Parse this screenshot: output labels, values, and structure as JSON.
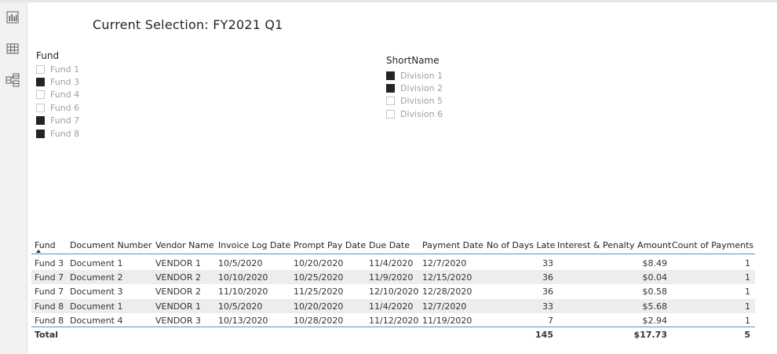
{
  "rail": {
    "icons": [
      "report-view-icon",
      "data-view-icon",
      "model-view-icon"
    ]
  },
  "page": {
    "title": "Current Selection: FY2021 Q1"
  },
  "slicers": {
    "fund": {
      "header": "Fund",
      "items": [
        {
          "label": "Fund 1",
          "checked": false
        },
        {
          "label": "Fund 3",
          "checked": true
        },
        {
          "label": "Fund 4",
          "checked": false
        },
        {
          "label": "Fund 6",
          "checked": false
        },
        {
          "label": "Fund 7",
          "checked": true
        },
        {
          "label": "Fund 8",
          "checked": true
        }
      ]
    },
    "shortname": {
      "header": "ShortName",
      "items": [
        {
          "label": "Division 1",
          "checked": true
        },
        {
          "label": "Division 2",
          "checked": true
        },
        {
          "label": "Division 5",
          "checked": false
        },
        {
          "label": "Division 6",
          "checked": false
        }
      ]
    }
  },
  "table": {
    "columns": [
      "Fund",
      "Document Number",
      "Vendor Name",
      "Invoice Log Date",
      "Prompt Pay Date",
      "Due Date",
      "Payment Date",
      "No of Days Late",
      "Interest & Penalty Amount",
      "Count of Payments"
    ],
    "rows": [
      [
        "Fund 3",
        "Document 1",
        "VENDOR 1",
        "10/5/2020",
        "10/20/2020",
        "11/4/2020",
        "12/7/2020",
        "33",
        "$8.49",
        "1"
      ],
      [
        "Fund 7",
        "Document 2",
        "VENDOR 2",
        "10/10/2020",
        "10/25/2020",
        "11/9/2020",
        "12/15/2020",
        "36",
        "$0.04",
        "1"
      ],
      [
        "Fund 7",
        "Document 3",
        "VENDOR 2",
        "11/10/2020",
        "11/25/2020",
        "12/10/2020",
        "12/28/2020",
        "36",
        "$0.58",
        "1"
      ],
      [
        "Fund 8",
        "Document 1",
        "VENDOR 1",
        "10/5/2020",
        "10/20/2020",
        "11/4/2020",
        "12/7/2020",
        "33",
        "$5.68",
        "1"
      ],
      [
        "Fund 8",
        "Document 4",
        "VENDOR 3",
        "10/13/2020",
        "10/28/2020",
        "11/12/2020",
        "11/19/2020",
        "7",
        "$2.94",
        "1"
      ]
    ],
    "total": {
      "label": "Total",
      "days_late": "145",
      "amount": "$17.73",
      "count": "5"
    }
  }
}
